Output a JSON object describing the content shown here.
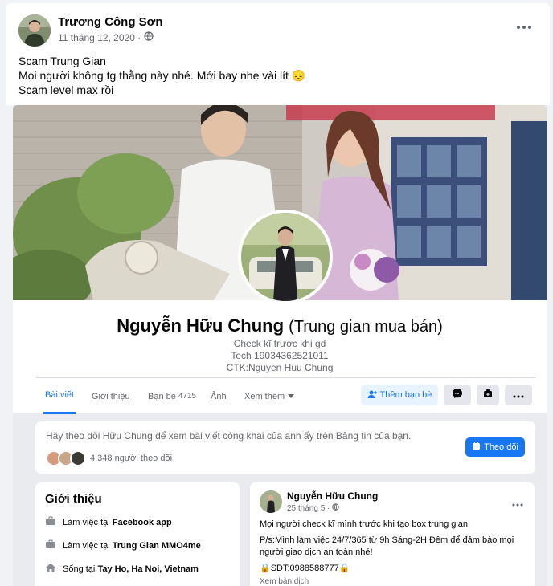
{
  "post": {
    "author": "Trương Công Sơn",
    "date": "11 tháng 12, 2020 ·",
    "lines": [
      "Scam Trung Gian",
      "Mọi người không tg thằng này nhé. Mới bay nhẹ vài lít 😞",
      "Scam level max rồi"
    ]
  },
  "profile": {
    "name": "Nguyễn Hữu Chung",
    "subtitle": "(Trung gian mua bán)",
    "bio": [
      "Check kĩ trước khi gd",
      "Tech 19034362521011",
      "CTK:Nguyen Huu Chung"
    ],
    "tabs": [
      {
        "label": "Bài viết",
        "active": true
      },
      {
        "label": "Giới thiệu"
      },
      {
        "label": "Bạn bè",
        "count": "4715"
      },
      {
        "label": "Ảnh"
      },
      {
        "label": "Xem thêm"
      }
    ],
    "add_friend": "Thêm bạn bè"
  },
  "follow": {
    "text": "Hãy theo dõi Hữu Chung để xem bài viết công khai của anh ấy trên Bảng tin của bạn.",
    "count": "4.348 người theo dõi",
    "button": "Theo dõi"
  },
  "intro": {
    "title": "Giới thiệu",
    "items": [
      {
        "prefix": "Làm việc tại",
        "value": "Facebook app",
        "icon": "briefcase-icon"
      },
      {
        "prefix": "Làm việc tại",
        "value": "Trung Gian MMO4me",
        "icon": "briefcase-icon"
      },
      {
        "prefix": "Sống tại",
        "value": "Tay Ho, Ha Noi, Vietnam",
        "icon": "home-icon"
      }
    ]
  },
  "inner_post": {
    "author": "Nguyễn Hữu Chung",
    "date": "25 tháng 5 ·",
    "p1": "Mọi người check kĩ mình trước khi tạo box trung gian!",
    "p2": "P/s:Mình làm việc 24/7/365 từ 9h Sáng-2H Đêm để đảm bảo mọi người giao dịch an toàn nhé!",
    "p3": "🔒SDT:0988588777🔒",
    "see_translation": "Xem bản dịch"
  },
  "colors": {
    "accent": "#1877f2",
    "secondary_text": "#65676b"
  }
}
